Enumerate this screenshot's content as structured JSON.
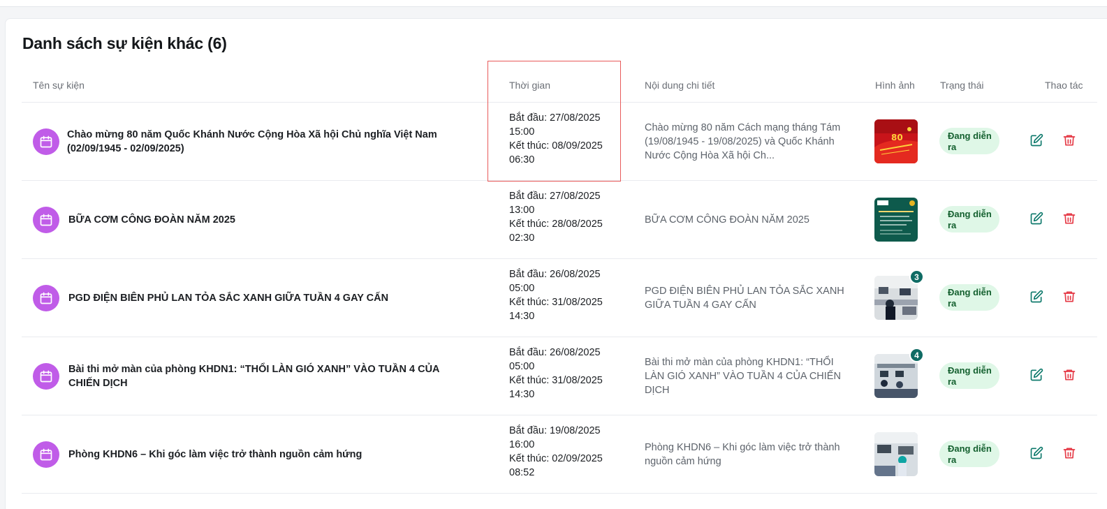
{
  "section": {
    "title": "Danh sách sự kiện khác (6)"
  },
  "table": {
    "headers": {
      "name": "Tên sự kiện",
      "time": "Thời gian",
      "detail": "Nội dung chi tiết",
      "image": "Hình ảnh",
      "status": "Trạng thái",
      "actions": "Thao tác"
    },
    "rows": [
      {
        "name": "Chào mừng 80 năm Quốc Khánh Nước Cộng Hòa Xã hội Chủ nghĩa Việt Nam (02/09/1945 - 02/09/2025)",
        "start_date": "Bắt đầu: 27/08/2025",
        "start_time": "15:00",
        "end_date": "Kết thúc: 08/09/2025",
        "end_time": "06:30",
        "detail": "Chào mừng 80 năm Cách mạng tháng Tám (19/08/1945 - 19/08/2025) và Quốc Khánh Nước Cộng Hòa Xã hội Ch...",
        "status": "Đang diễn ra",
        "image_count": ""
      },
      {
        "name": "BỮA CƠM CÔNG ĐOÀN NĂM 2025",
        "start_date": "Bắt đầu: 27/08/2025",
        "start_time": "13:00",
        "end_date": "Kết thúc: 28/08/2025",
        "end_time": "02:30",
        "detail": "BỮA CƠM CÔNG ĐOÀN NĂM 2025",
        "status": "Đang diễn ra",
        "image_count": ""
      },
      {
        "name": "PGD ĐIỆN BIÊN PHỦ LAN TỎA SẮC XANH GIỮA TUẦN 4 GAY CẤN",
        "start_date": "Bắt đầu: 26/08/2025",
        "start_time": "05:00",
        "end_date": "Kết thúc: 31/08/2025",
        "end_time": "14:30",
        "detail": "PGD ĐIỆN BIÊN PHỦ LAN TỎA SẮC XANH GIỮA TUẦN 4 GAY CẤN",
        "status": "Đang diễn ra",
        "image_count": "3"
      },
      {
        "name": "Bài thi mở màn của phòng KHDN1: “THỔI LÀN GIÓ XANH” VÀO TUẦN 4 CỦA CHIẾN DỊCH",
        "start_date": "Bắt đầu: 26/08/2025",
        "start_time": "05:00",
        "end_date": "Kết thúc: 31/08/2025",
        "end_time": "14:30",
        "detail": "Bài thi mở màn của phòng KHDN1: “THỔI LÀN GIÓ XANH” VÀO TUẦN 4 CỦA CHIẾN DỊCH",
        "status": "Đang diễn ra",
        "image_count": "4"
      },
      {
        "name": "Phòng KHDN6 – Khi góc làm việc trở thành nguồn cảm hứng",
        "start_date": "Bắt đầu: 19/08/2025",
        "start_time": "16:00",
        "end_date": "Kết thúc: 02/09/2025",
        "end_time": "08:52",
        "detail": "Phòng KHDN6 – Khi góc làm việc trở thành nguồn cảm hứng",
        "status": "Đang diễn ra",
        "image_count": ""
      }
    ]
  },
  "icons": {
    "event": "calendar-icon",
    "edit": "edit-icon",
    "delete": "trash-icon"
  },
  "colors": {
    "event_icon_bg": "#c05ce8",
    "status_bg": "#dff7e7",
    "status_text": "#14602f",
    "edit_icon": "#0f7a6c",
    "delete_icon": "#e53945",
    "badge_bg": "#0f6b64",
    "highlight_border": "#e85a5a"
  }
}
